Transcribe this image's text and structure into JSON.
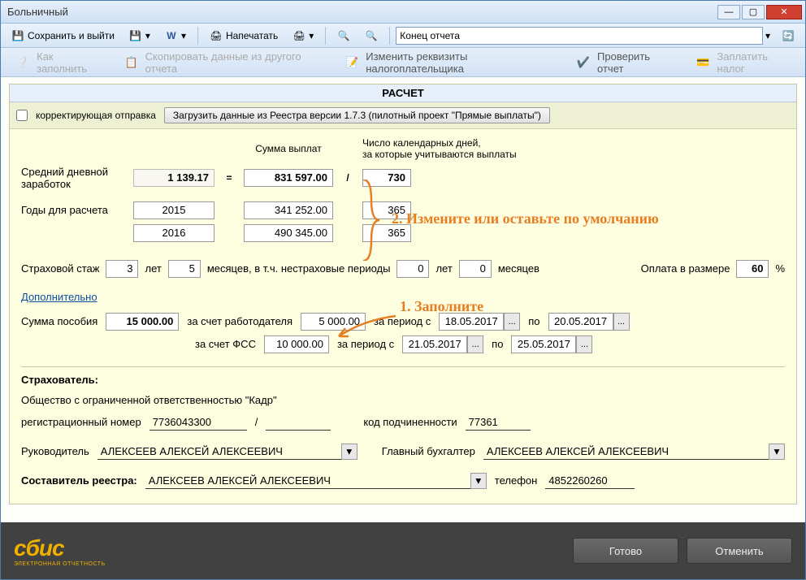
{
  "window": {
    "title": "Больничный"
  },
  "titlebar_buttons": {
    "min": "—",
    "max": "▢",
    "close": "✕"
  },
  "toolbar1": {
    "save_exit": "Сохранить и выйти",
    "print": "Напечатать",
    "nav_select": "Конец отчета"
  },
  "toolbar2": {
    "how_fill": "Как заполнить",
    "copy_data": "Скопировать данные из другого отчета",
    "change_req": "Изменить реквизиты налогоплательщика",
    "check_report": "Проверить отчет",
    "pay_tax": "Заплатить налог"
  },
  "panel": {
    "header": "РАСЧЕТ",
    "correcting": "корректирующая отправка",
    "load_btn": "Загрузить данные из Реестра версии 1.7.3 (пилотный проект \"Прямые выплаты\")"
  },
  "calc": {
    "sum_vypl_hdr": "Сумма выплат",
    "days_hdr": "Число календарных дней,\nза которые учитываются выплаты",
    "avg_label": "Средний дневной заработок",
    "avg_value": "1 139.17",
    "total_sum": "831 597.00",
    "total_days": "730",
    "years_label": "Годы для расчета",
    "year1": "2015",
    "sum1": "341 252.00",
    "days1": "365",
    "year2": "2016",
    "sum2": "490 345.00",
    "days2": "365"
  },
  "stazh": {
    "label": "Страховой стаж",
    "years": "3",
    "years_u": "лет",
    "months": "5",
    "months_u": "месяцев, в т.ч. нестраховые периоды",
    "ny": "0",
    "ny_u": "лет",
    "nm": "0",
    "nm_u": "месяцев",
    "pay_label": "Оплата в размере",
    "pay_pct": "60",
    "pct": "%"
  },
  "extra_link": "Дополнительно",
  "benefit": {
    "label": "Сумма пособия",
    "total": "15 000.00",
    "employer_lbl": "за счет работодателя",
    "employer_val": "5 000.00",
    "period_from_lbl": "за период с",
    "emp_from": "18.05.2017",
    "to_lbl": "по",
    "emp_to": "20.05.2017",
    "fss_lbl": "за счет ФСС",
    "fss_val": "10 000.00",
    "fss_from": "21.05.2017",
    "fss_to": "25.05.2017"
  },
  "annotations": {
    "a1": "1. Заполните",
    "a2": "2. Измените или оставьте по умолчанию"
  },
  "insurer": {
    "header": "Страхователь:",
    "org": "Общество с ограниченной ответственностью \"Кадр\"",
    "reg_lbl": "регистрационный номер",
    "reg_no": "7736043300",
    "slash": "/",
    "sub_lbl": "код подчиненности",
    "sub_code": "77361",
    "head_lbl": "Руководитель",
    "head_name": "АЛЕКСЕЕВ АЛЕКСЕЙ АЛЕКСЕЕВИЧ",
    "acc_lbl": "Главный бухгалтер",
    "acc_name": "АЛЕКСЕЕВ АЛЕКСЕЙ АЛЕКСЕЕВИЧ",
    "compiler_lbl": "Составитель реестра:",
    "compiler_name": "АЛЕКСЕЕВ АЛЕКСЕЙ АЛЕКСЕЕВИЧ",
    "phone_lbl": "телефон",
    "phone": "4852260260"
  },
  "footer": {
    "logo": "сбис",
    "logo_sub": "ЭЛЕКТРОННАЯ ОТЧЕТНОСТЬ",
    "ok": "Готово",
    "cancel": "Отменить"
  }
}
